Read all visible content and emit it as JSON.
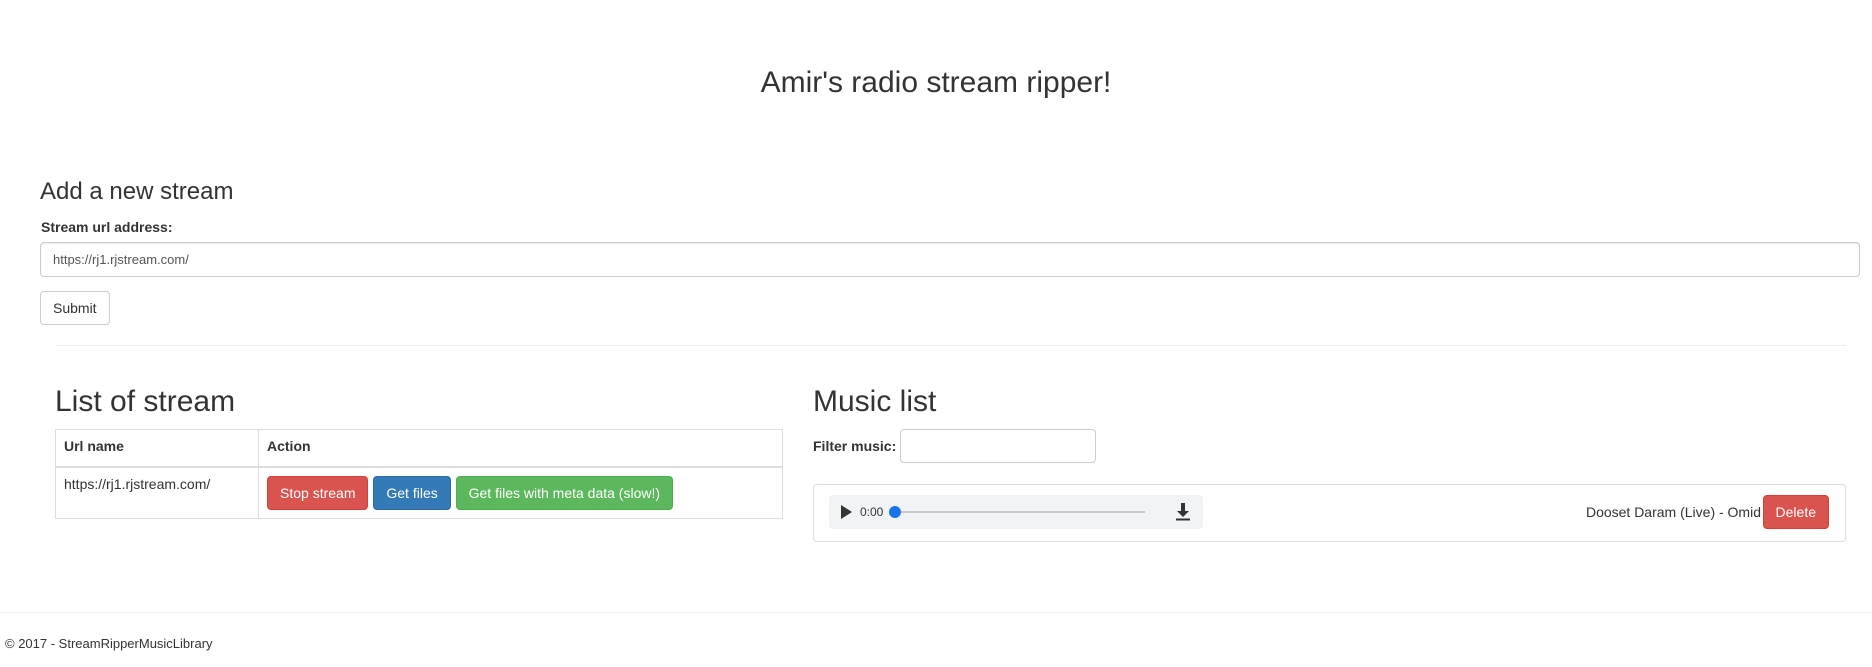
{
  "header": {
    "title": "Amir's radio stream ripper!"
  },
  "add_stream": {
    "title": "Add a new stream",
    "url_label": "Stream url address:",
    "url_value": "https://rj1.rjstream.com/",
    "submit_label": "Submit"
  },
  "streams": {
    "title": "List of stream",
    "columns": [
      "Url name",
      "Action"
    ],
    "rows": [
      {
        "url": "https://rj1.rjstream.com/",
        "stop_label": "Stop stream",
        "get_files_label": "Get files",
        "get_meta_label": "Get files with meta data (slow!)"
      }
    ]
  },
  "music": {
    "title": "Music list",
    "filter_label": "Filter music:",
    "filter_value": "",
    "items": [
      {
        "current_time": "0:00",
        "progress": 0,
        "song": "Dooset Daram (Live) - Omid",
        "delete_label": "Delete"
      }
    ]
  },
  "footer": {
    "text": "© 2017 - StreamRipperMusicLibrary"
  },
  "colors": {
    "danger": "#d9534f",
    "primary": "#337ab7",
    "success": "#5cb85c",
    "player_accent": "#1a73e8"
  }
}
